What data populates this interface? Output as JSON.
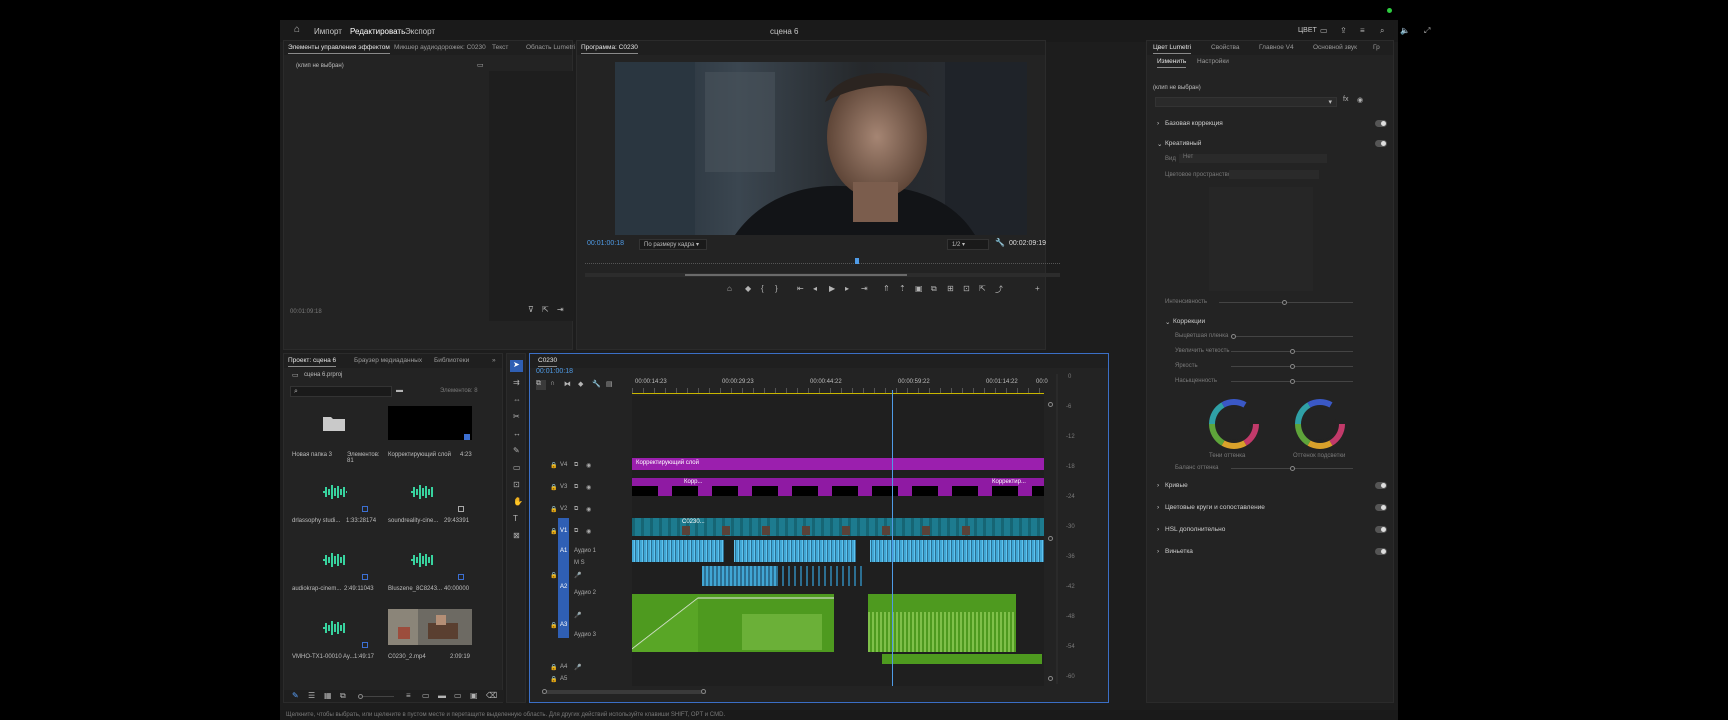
{
  "topbar": {
    "tabs": [
      "Импорт",
      "Редактировать",
      "Экспорт"
    ],
    "title": "сцена 6",
    "right_label": "ЦВЕТ"
  },
  "effect_controls": {
    "tabs": [
      "Элементы управления эффектом",
      "Микшер аудиодорожек: C0230",
      "Текст",
      "Область Lumetri"
    ],
    "no_clip": "(клип не выбран)",
    "timecode": "00:01:09:18"
  },
  "program_monitor": {
    "tab": "Программа: C0230",
    "current_time": "00:01:00:18",
    "fit_label": "По размеру кадра",
    "quality": "1/2",
    "duration": "00:02:09:19"
  },
  "project": {
    "tabs": [
      "Проект: сцена 6",
      "Браузер медиаданных",
      "Библиотеки"
    ],
    "file": "сцена 6.prproj",
    "selection": "Элементов: 8",
    "items": [
      {
        "name": "Новая папка 3",
        "meta": "Элементов: 81",
        "kind": "folder"
      },
      {
        "name": "Корректирующий слой",
        "meta": "4:23",
        "kind": "black"
      },
      {
        "name": "drlassophy studi...",
        "meta": "1:33:28174",
        "kind": "audio"
      },
      {
        "name": "soundreality-cine...",
        "meta": "29:43391",
        "kind": "audio"
      },
      {
        "name": "audiokrap-cinem...",
        "meta": "2:49:11043",
        "kind": "audio"
      },
      {
        "name": "Bluszene_8C8243...",
        "meta": "40:00000",
        "kind": "audio"
      },
      {
        "name": "VMHO-TX1-00010 Ay...",
        "meta": "1:49:17",
        "kind": "audio"
      },
      {
        "name": "C0230_2.mp4",
        "meta": "2:09:19",
        "kind": "video"
      }
    ]
  },
  "timeline": {
    "tab": "C0230",
    "current_time": "00:01:00:18",
    "ruler": [
      "00:00:14:23",
      "00:00:29:23",
      "00:00:44:22",
      "00:00:59:22",
      "00:01:14:22",
      "00:0"
    ],
    "tracks": [
      "V4",
      "V3",
      "V2",
      "V1",
      "A1",
      "A2",
      "A3",
      "A4",
      "A5"
    ],
    "audio_names": [
      "Аудио 1",
      "Аудио 2",
      "Аудио 3"
    ],
    "adjustment_label": "Корректирующий слой",
    "adjustment_label_2": "Корр...",
    "adjustment_label_3": "Корректир...",
    "clip_label": "C0230...",
    "meter_ticks": [
      "0",
      "-6",
      "-12",
      "-18",
      "-24",
      "-30",
      "-36",
      "-42",
      "-48",
      "-54",
      "-60"
    ]
  },
  "lumetri": {
    "tabs": [
      "Цвет Lumetri",
      "Свойства",
      "Главное V4",
      "Основной звук",
      "Гр"
    ],
    "subtabs": [
      "Изменить",
      "Настройки"
    ],
    "no_clip": "(клип не выбран)",
    "sections": [
      "Базовая коррекция",
      "Креативный",
      "Кривые",
      "Цветовые круги и сопоставление",
      "HSL дополнительно",
      "Виньетка"
    ],
    "look_label": "Вид",
    "look_value": "Нет",
    "preset_label": "Цветовое пространство",
    "intensity_label": "Интенсивность",
    "corrections": "Коррекции",
    "corr_rows": [
      "Выцветшая пленка",
      "Увеличить четкость",
      "Яркость",
      "Насыщенность"
    ],
    "shadow_tint": "Тени оттенка",
    "highlight_tint": "Оттенок подсветки",
    "balance": "Баланс оттенка"
  },
  "status": "Щелкните, чтобы выбрать, или щелкните в пустом месте и перетащите выделенную область. Для других действий используйте клавиши SHIFT, OPT и CMD."
}
